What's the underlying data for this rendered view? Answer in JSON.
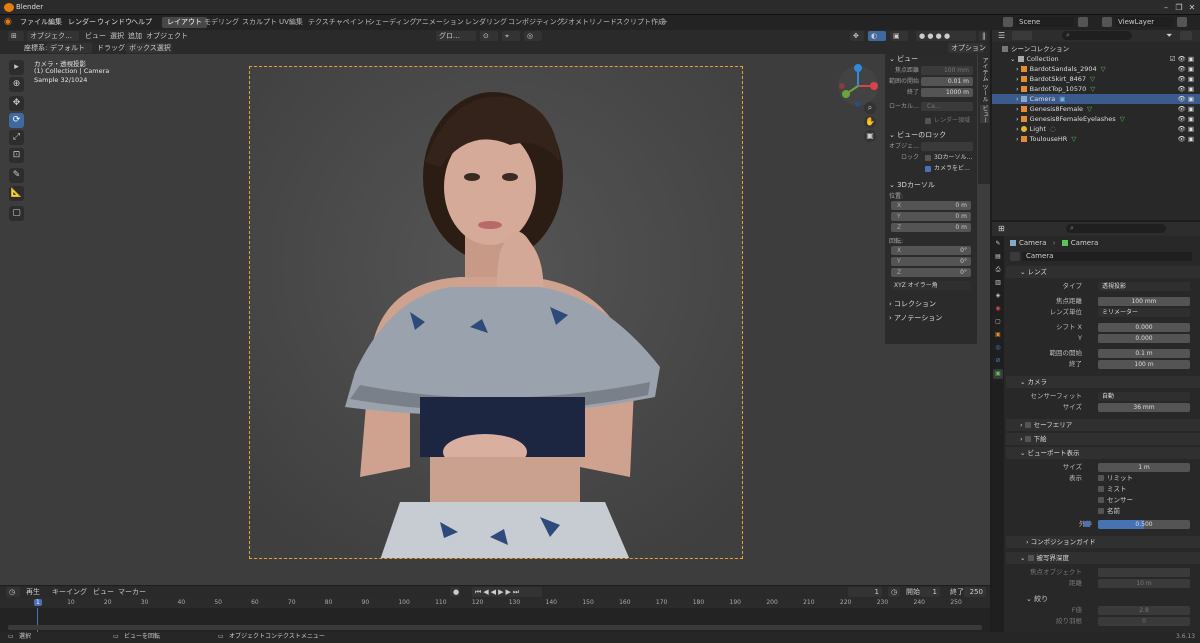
{
  "app": {
    "title": "Blender"
  },
  "menu": {
    "items": [
      "ファイル",
      "編集",
      "レンダー",
      "ウィンドウ",
      "ヘルプ"
    ],
    "workspaces": [
      "レイアウト",
      "モデリング",
      "スカルプト",
      "UV編集",
      "テクスチャペイント",
      "シェーディング",
      "アニメーション",
      "レンダリング",
      "コンポジティング",
      "ジオメトリノード",
      "スクリプト作成",
      "+"
    ],
    "active_workspace": "レイアウト",
    "scene": "Scene",
    "view_layer": "ViewLayer"
  },
  "viewport_header": {
    "mode": "オブジェク…",
    "menus": [
      "ビュー",
      "選択",
      "追加",
      "オブジェクト"
    ],
    "transform": "グロ…",
    "coord_label": "座標系:",
    "coord_value": "デフォルト",
    "drag": "ドラッグ:",
    "box_select": "ボックス選択",
    "options": "オプション"
  },
  "overlay_text": {
    "line1": "カメラ・透視投影",
    "line2": "(1) Collection | Camera",
    "line3": "Sample 32/1024"
  },
  "npanel": {
    "view_section": "ビュー",
    "focal_label": "焦点距離",
    "focal_value": "100 mm",
    "clip_start_label": "範囲の開始",
    "clip_start_value": "0.01 m",
    "clip_end_label": "終了",
    "clip_end_value": "1000 m",
    "local_label": "ローカル…",
    "local_value": "Ca…",
    "render_region": "レンダー領域",
    "view_lock_section": "ビューのロック",
    "lock_object_label": "オブジェ…",
    "lock_label": "ロック",
    "lock_cursor": "3Dカーソル…",
    "lock_camera": "カメラをビ…",
    "cursor_section": "3Dカーソル",
    "location_label": "位置:",
    "rotation_label": "回転:",
    "x": "X",
    "y": "Y",
    "z": "Z",
    "loc_x": "0 m",
    "loc_y": "0 m",
    "loc_z": "0 m",
    "rot_x": "0°",
    "rot_y": "0°",
    "rot_z": "0°",
    "rot_mode": "XYZ オイラー角",
    "collection_section": "コレクション",
    "annotation_section": "アノテーション",
    "tabs": [
      "アイテム",
      "ツール",
      "ビュー"
    ]
  },
  "timeline": {
    "menus": [
      "再生",
      "キーイング",
      "ビュー",
      "マーカー"
    ],
    "current_frame": "1",
    "start_label": "開始",
    "start": "1",
    "end_label": "終了",
    "end": "250",
    "ticks": [
      "1",
      "10",
      "20",
      "30",
      "40",
      "50",
      "60",
      "70",
      "80",
      "90",
      "100",
      "110",
      "120",
      "130",
      "140",
      "150",
      "160",
      "170",
      "180",
      "190",
      "200",
      "210",
      "220",
      "230",
      "240",
      "250"
    ]
  },
  "statusbar": {
    "select": "選択",
    "rotate": "ビューを回転",
    "context": "オブジェクトコンテクストメニュー",
    "version": "3.6.13"
  },
  "outliner": {
    "title": "シーンコレクション",
    "collection": "Collection",
    "items": [
      {
        "name": "BardotSandals_2904",
        "selected": false
      },
      {
        "name": "BardotSkirt_8467",
        "selected": false
      },
      {
        "name": "BardotTop_10570",
        "selected": false
      },
      {
        "name": "Camera",
        "selected": true
      },
      {
        "name": "Genesis8Female",
        "selected": false
      },
      {
        "name": "Genesis8FemaleEyelashes",
        "selected": false
      },
      {
        "name": "Light",
        "selected": false
      },
      {
        "name": "ToulouseHR",
        "selected": false
      }
    ]
  },
  "properties": {
    "breadcrumb_object": "Camera",
    "breadcrumb_data": "Camera",
    "data_name": "Camera",
    "lens_section": "レンズ",
    "type_label": "タイプ",
    "type_value": "透視投影",
    "focal_label": "焦点距離",
    "focal_value": "100 mm",
    "lens_unit_label": "レンズ単位",
    "lens_unit_value": "ミリメーター",
    "shift_x_label": "シフト X",
    "shift_x_value": "0.000",
    "shift_y_label": "Y",
    "shift_y_value": "0.000",
    "clip_start_label": "範囲の開始",
    "clip_start_value": "0.1 m",
    "clip_end_label": "終了",
    "clip_end_value": "100 m",
    "camera_section": "カメラ",
    "sensor_fit_label": "センサーフィット",
    "sensor_fit_value": "自動",
    "size_label": "サイズ",
    "size_value": "36 mm",
    "safe_areas_section": "セーフエリア",
    "background_section": "下絵",
    "viewport_display_section": "ビューポート表示",
    "vp_size_label": "サイズ",
    "vp_size_value": "1 m",
    "show_label": "表示",
    "show_limits": "リミット",
    "show_mist": "ミスト",
    "show_sensor": "センサー",
    "show_name": "名前",
    "passepartout_label": "外枠",
    "passepartout_value": "0.500",
    "passepartout_fraction": 0.5,
    "composition_section": "コンポジションガイド",
    "dof_section": "被写界深度",
    "focus_object_label": "焦点オブジェクト",
    "distance_label": "距離",
    "distance_value": "10 m",
    "aperture_section": "絞り",
    "fstop_label": "F値",
    "fstop_value": "2.8",
    "blades_label": "絞り羽根",
    "blades_value": "0"
  },
  "colors": {
    "accent": "#4772b3",
    "camera_frame": "#e5a237",
    "playhead": "#4772b3"
  }
}
